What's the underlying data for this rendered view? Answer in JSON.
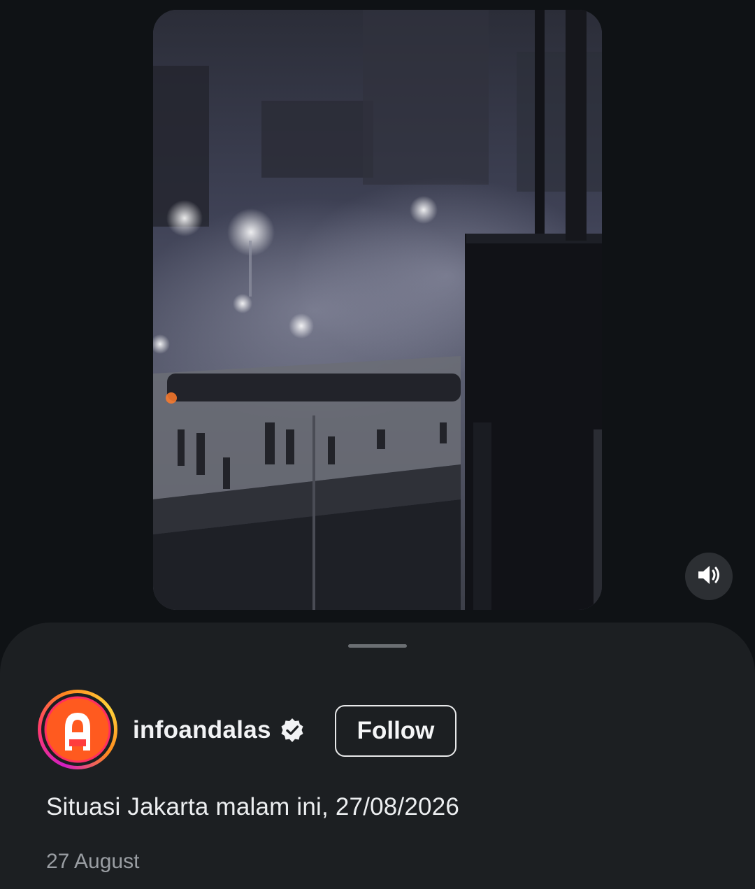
{
  "video": {
    "scene": "night-street-scene-thumbnail",
    "mute_icon": "speaker-volume-icon"
  },
  "post": {
    "username": "infoandalas",
    "verified_icon": "verified-badge-icon",
    "follow_label": "Follow",
    "caption": "Situasi Jakarta malam ini, 27/08/2026",
    "date": "27 August"
  },
  "colors": {
    "background": "#0f1215",
    "sheet": "#1c1f22",
    "text_primary": "#f2f3f5",
    "text_secondary": "#9a9ea3",
    "avatar_ring_start": "#d21ec4",
    "avatar_ring_end": "#ffd23a",
    "avatar_fill": "#ff5a1f"
  }
}
